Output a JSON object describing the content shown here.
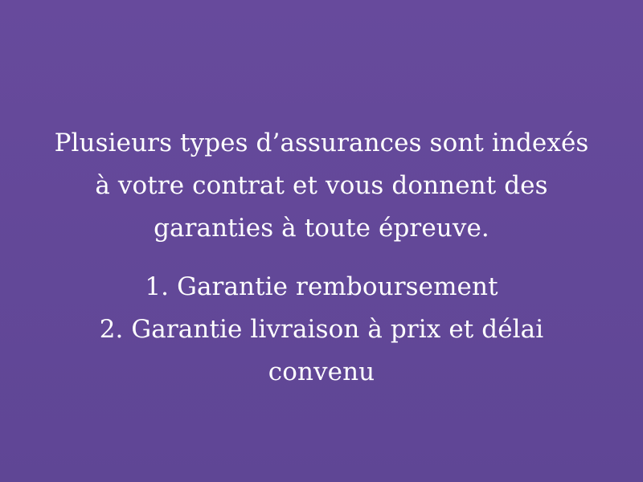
{
  "paragraph": {
    "lines": [
      "Plusieurs types d’assurances sont indexés",
      "à votre contrat et vous donnent des",
      "garanties à toute épreuve."
    ]
  },
  "list": {
    "items": [
      {
        "lines": [
          "1. Garantie remboursement"
        ]
      },
      {
        "lines": [
          "2. Garantie livraison à prix et délai",
          "convenu"
        ]
      }
    ]
  },
  "colors": {
    "background": "#634898",
    "text": "#ffffff"
  }
}
